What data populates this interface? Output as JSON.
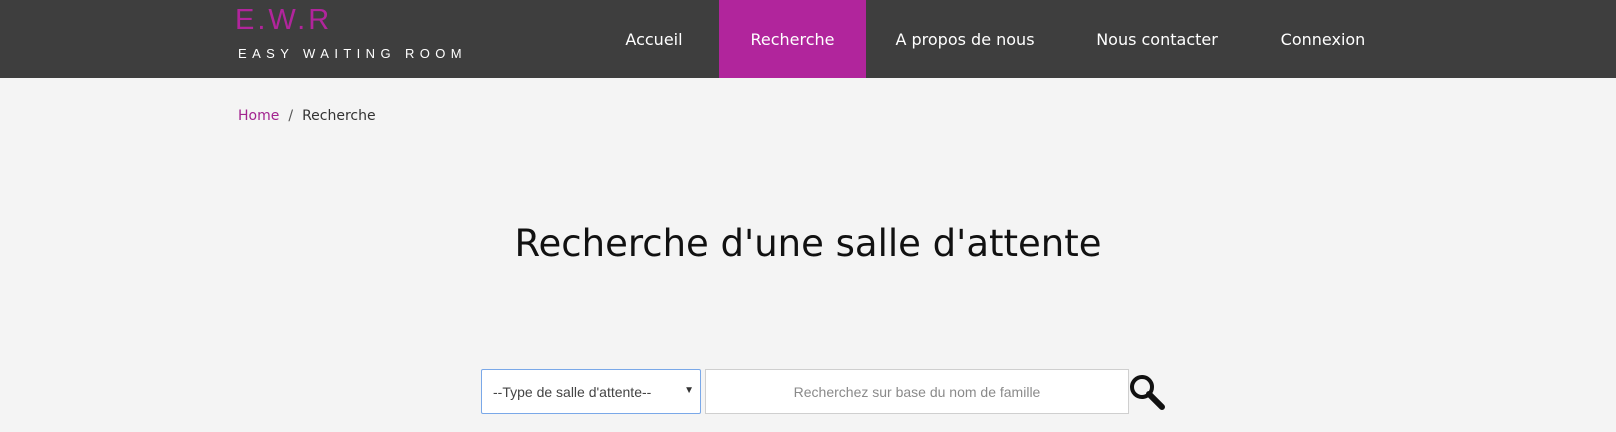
{
  "logo": {
    "title": "E.W.R",
    "subtitle": "EASY WAITING ROOM"
  },
  "nav": {
    "items": [
      {
        "label": "Accueil"
      },
      {
        "label": "Recherche"
      },
      {
        "label": "A propos de nous"
      },
      {
        "label": "Nous contacter"
      },
      {
        "label": "Connexion"
      }
    ]
  },
  "breadcrumb": {
    "home": "Home",
    "separator": "/",
    "current": "Recherche"
  },
  "main": {
    "title": "Recherche d'une salle d'attente",
    "type_select": {
      "selected": "--Type de salle d'attente--"
    },
    "search": {
      "placeholder": "Recherchez sur base du nom de famille"
    }
  },
  "colors": {
    "accent": "#b1259c",
    "header_bg": "#3e3e3e",
    "page_bg": "#f4f4f4"
  },
  "icons": {
    "search_button": "search-icon",
    "select_arrow": "caret-down-icon"
  }
}
